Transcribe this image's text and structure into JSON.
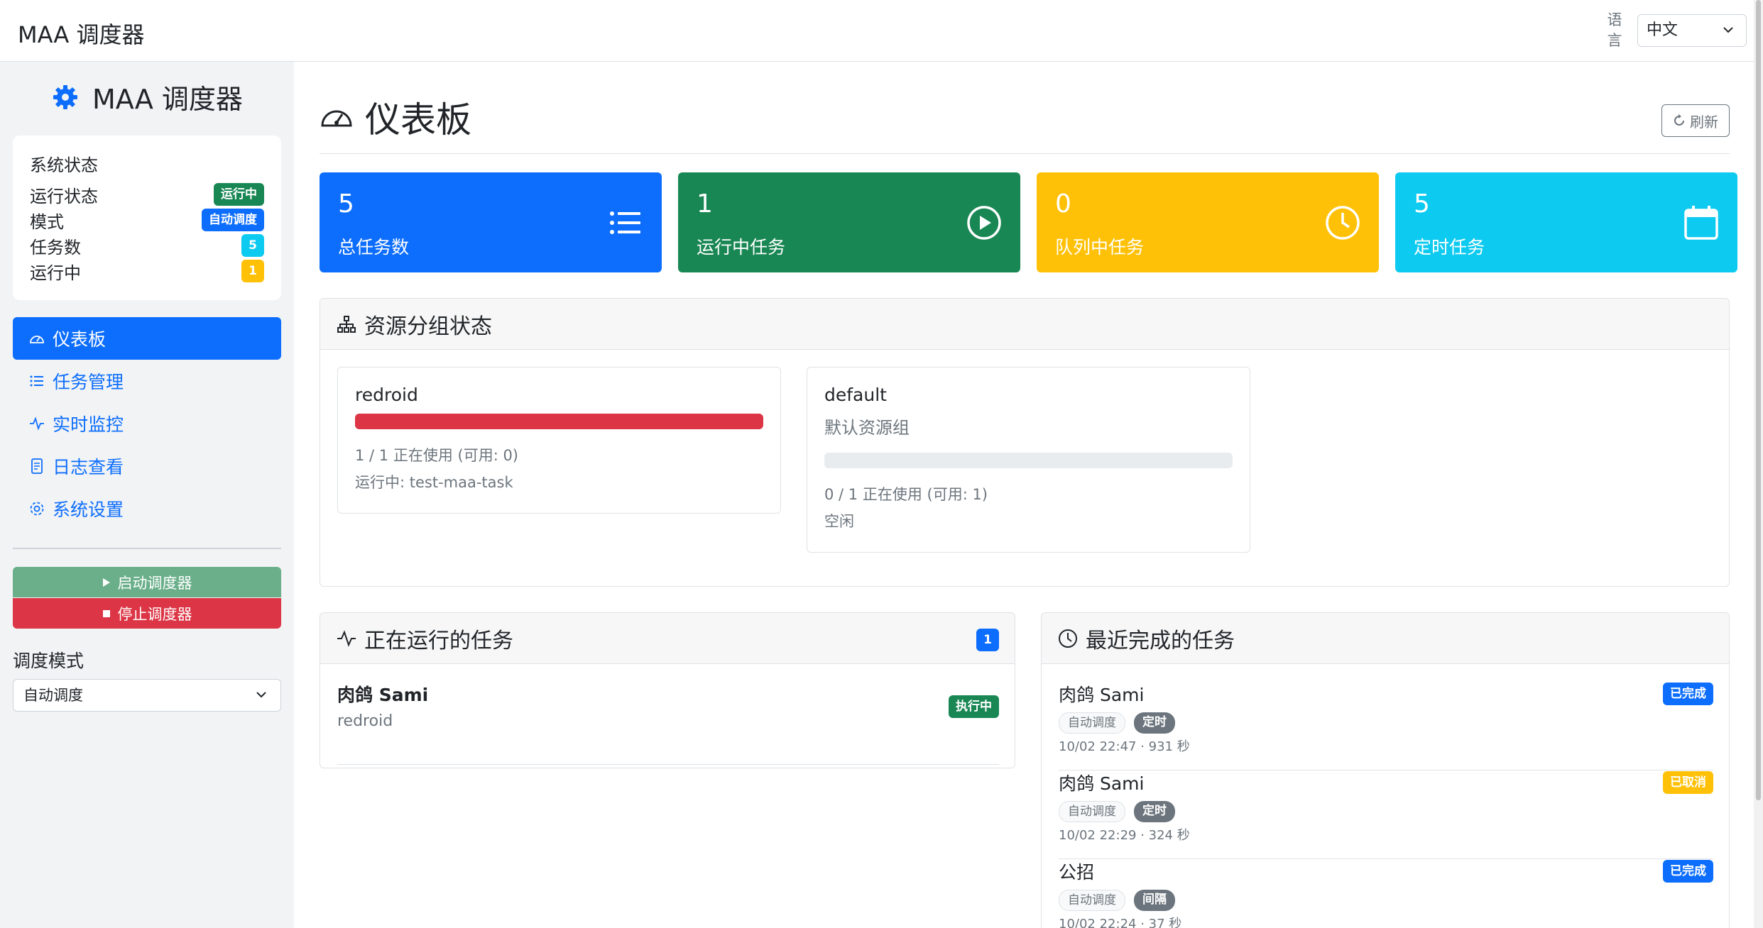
{
  "topbar": {
    "brand": "MAA 调度器",
    "language_label": "语言",
    "language_value": "中文"
  },
  "sidebar": {
    "brand": "MAA 调度器",
    "status": {
      "title": "系统状态",
      "rows": [
        {
          "label": "运行状态",
          "value": "运行中",
          "color": "#198754"
        },
        {
          "label": "模式",
          "value": "自动调度",
          "color": "#0d6efd"
        },
        {
          "label": "任务数",
          "value": "5",
          "color": "#0dcaf0"
        },
        {
          "label": "运行中",
          "value": "1",
          "color": "#ffc107"
        }
      ]
    },
    "nav": [
      {
        "label": "仪表板",
        "icon": "speedometer-icon",
        "active": true
      },
      {
        "label": "任务管理",
        "icon": "list-icon",
        "active": false
      },
      {
        "label": "实时监控",
        "icon": "activity-icon",
        "active": false
      },
      {
        "label": "日志查看",
        "icon": "document-icon",
        "active": false
      },
      {
        "label": "系统设置",
        "icon": "gear-icon",
        "active": false
      }
    ],
    "start_label": "启动调度器",
    "stop_label": "停止调度器",
    "mode_label": "调度模式",
    "mode_value": "自动调度"
  },
  "main": {
    "title": "仪表板",
    "refresh_label": "刷新",
    "stats": [
      {
        "value": "5",
        "label": "总任务数",
        "color": "#0d6efd",
        "icon": "list-icon"
      },
      {
        "value": "1",
        "label": "运行中任务",
        "color": "#198754",
        "icon": "play-circle-icon"
      },
      {
        "value": "0",
        "label": "队列中任务",
        "color": "#ffc107",
        "icon": "clock-icon"
      },
      {
        "value": "5",
        "label": "定时任务",
        "color": "#0dcaf0",
        "icon": "calendar-icon"
      }
    ],
    "resources": {
      "title": "资源分组状态",
      "groups": [
        {
          "name": "redroid",
          "description": "",
          "usage_fraction": 1.0,
          "usage": "1 / 1 正在使用 (可用: 0)",
          "detail": "运行中: test-maa-task"
        },
        {
          "name": "default",
          "description": "默认资源组",
          "usage_fraction": 0.0,
          "usage": "0 / 1 正在使用 (可用: 1)",
          "detail": "空闲"
        }
      ]
    },
    "running": {
      "title": "正在运行的任务",
      "count": "1",
      "tasks": [
        {
          "name": "肉鸽 Sami",
          "group": "redroid",
          "status": "执行中"
        }
      ]
    },
    "recent": {
      "title": "最近完成的任务",
      "tasks": [
        {
          "name": "肉鸽 Sami",
          "tags": [
            "自动调度",
            "定时"
          ],
          "meta": "10/02 22:47 · 931 秒",
          "status": "已完成",
          "status_color": "#0d6efd"
        },
        {
          "name": "肉鸽 Sami",
          "tags": [
            "自动调度",
            "定时"
          ],
          "meta": "10/02 22:29 · 324 秒",
          "status": "已取消",
          "status_color": "#ffc107"
        },
        {
          "name": "公招",
          "tags": [
            "自动调度",
            "间隔"
          ],
          "meta": "10/02 22:24 · 37 秒",
          "status": "已完成",
          "status_color": "#0d6efd"
        }
      ]
    }
  }
}
